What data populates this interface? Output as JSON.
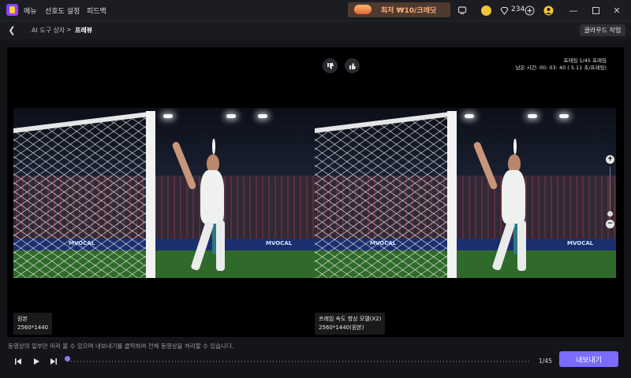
{
  "titlebar": {
    "menu": [
      "메뉴",
      "선호도 설정",
      "피드백"
    ],
    "promo_text": "최저 ₩10/크레딧",
    "credits": "234"
  },
  "nav": {
    "breadcrumb": [
      "AI 도구 상자",
      "프레뷰"
    ],
    "separator": ">",
    "cloud_button": "클라우드 작업"
  },
  "preview": {
    "frame_info_line1": "프레임 1/45 프레임",
    "frame_info_line2": "남은 시간: 00: 03: 40 ( 5.11 초/프레임)",
    "ad_text": "MVOCAL",
    "left_pane": {
      "title": "원본",
      "resolution": "2560*1440"
    },
    "right_pane": {
      "title": "프레임 속도 향상 모델(X2)",
      "resolution": "2560*1440(원본)"
    }
  },
  "bottom": {
    "notice": "동영상의 일부만 미리 볼 수 있으며 내보내기를 클릭하여 전체 동영상을 처리할 수 있습니다.",
    "counter": "1/45",
    "export_button": "내보내기",
    "progress_fraction": 0.0
  },
  "icons": {
    "logo": "app-logo-icon",
    "dislike": "thumbs-down-icon",
    "like": "thumbs-up-icon"
  }
}
